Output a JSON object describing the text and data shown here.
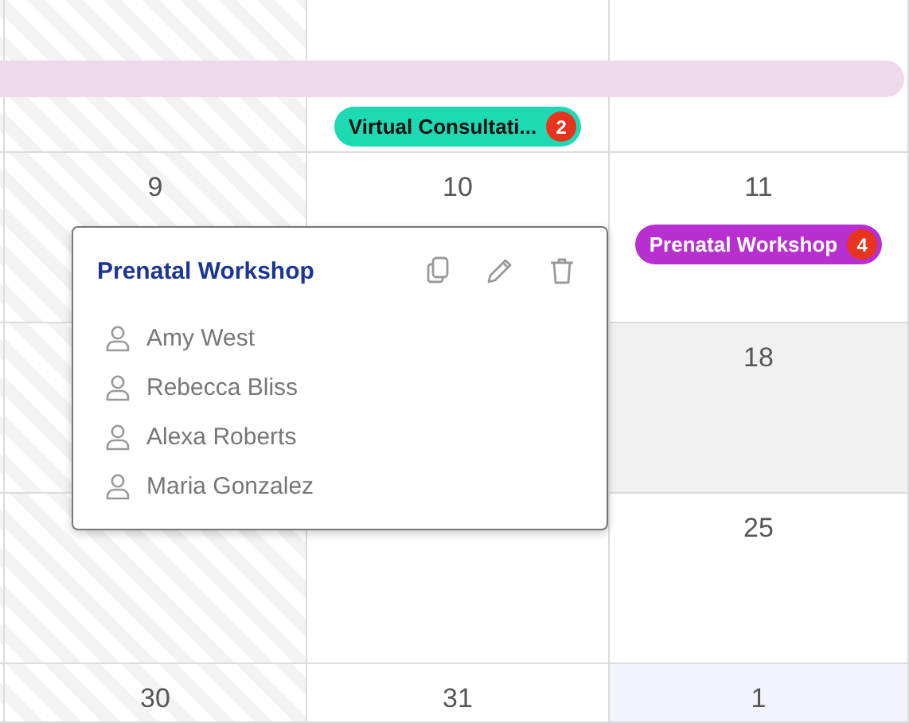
{
  "weeks": [
    {
      "banner": {
        "color": "#f0d8eb"
      },
      "days": [
        {
          "kind": "disabled"
        },
        {
          "kind": "disabled"
        },
        {
          "kind": "normal",
          "events": [
            {
              "label": "Virtual Consultati...",
              "count": "2",
              "color": "#1dd9b4"
            }
          ]
        },
        {
          "kind": "normal"
        }
      ]
    },
    {
      "days": [
        {
          "kind": "disabled"
        },
        {
          "kind": "disabled",
          "date": "9"
        },
        {
          "kind": "normal",
          "date": "10"
        },
        {
          "kind": "normal",
          "date": "11",
          "events": [
            {
              "label": "Prenatal Workshop",
              "count": "4",
              "color": "#b82fd0"
            }
          ]
        }
      ]
    },
    {
      "days": [
        {
          "kind": "disabled"
        },
        {
          "kind": "disabled"
        },
        {
          "kind": "normal"
        },
        {
          "kind": "today",
          "date": "18"
        }
      ]
    },
    {
      "days": [
        {
          "kind": "disabled"
        },
        {
          "kind": "disabled"
        },
        {
          "kind": "normal"
        },
        {
          "kind": "normal",
          "date": "25"
        }
      ]
    },
    {
      "days": [
        {
          "kind": "disabled"
        },
        {
          "kind": "disabled",
          "date": "30"
        },
        {
          "kind": "normal",
          "date": "31"
        },
        {
          "kind": "other_month",
          "date": "1"
        }
      ]
    }
  ],
  "popover": {
    "title": "Prenatal Workshop",
    "attendees": [
      "Amy West",
      "Rebecca Bliss",
      "Alexa Roberts",
      "Maria Gonzalez"
    ]
  }
}
